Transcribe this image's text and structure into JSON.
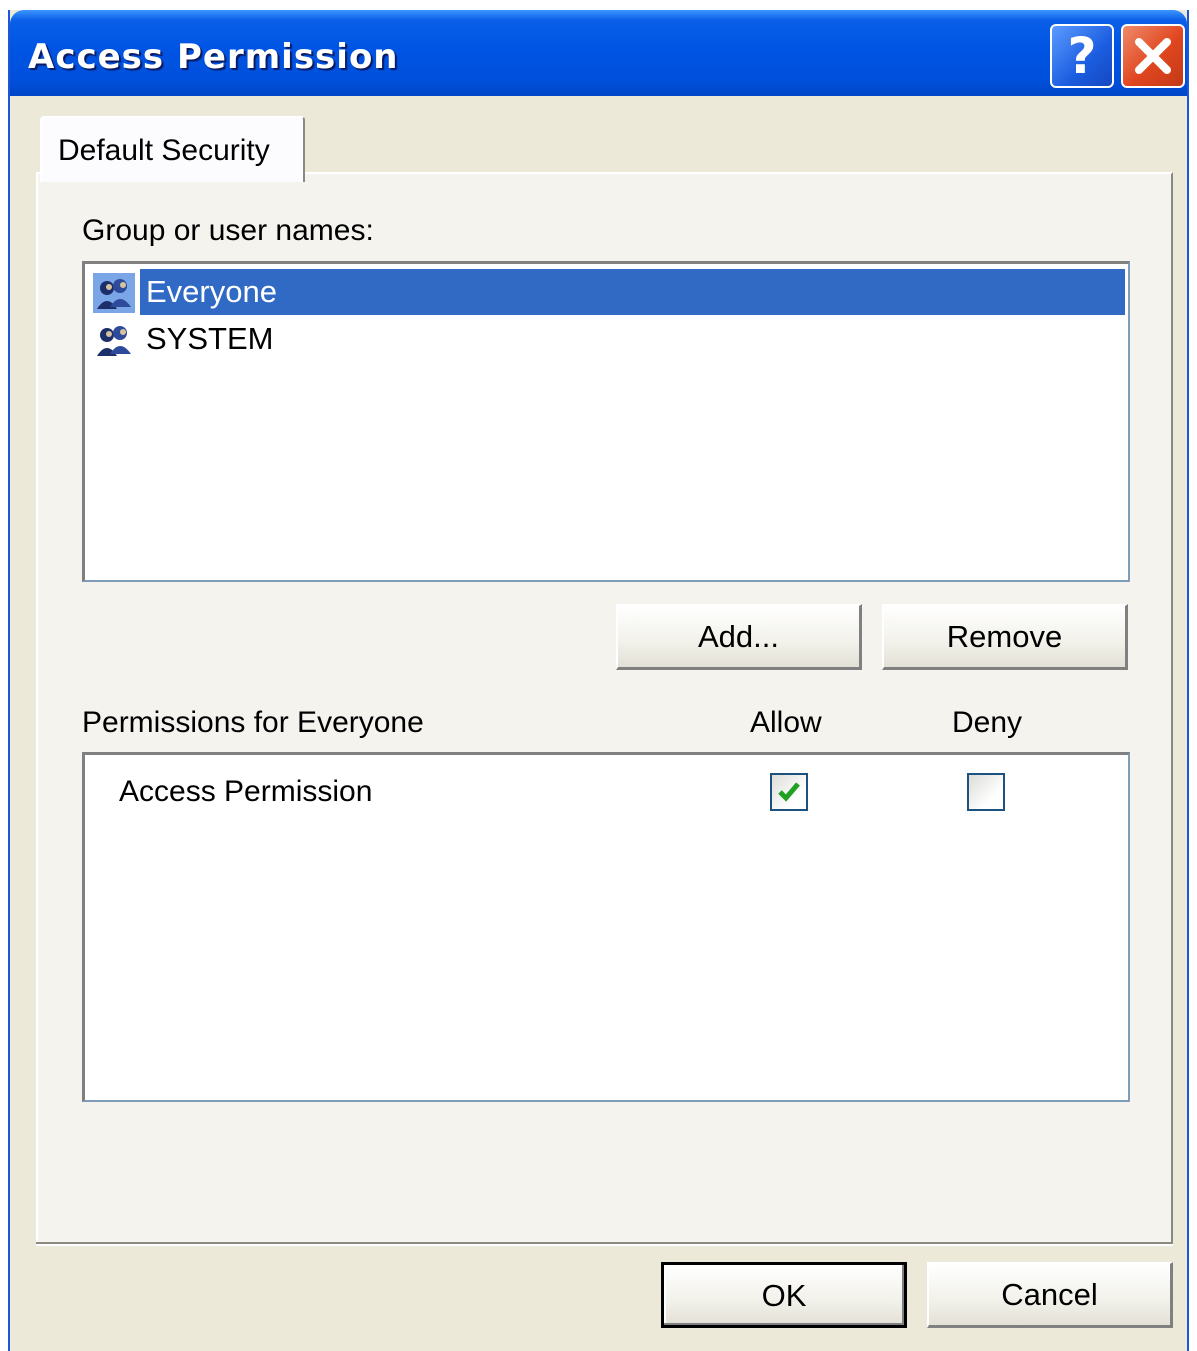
{
  "window": {
    "title": "Access Permission"
  },
  "titlebar": {
    "help_label": "?",
    "close_icon": "close-icon"
  },
  "tabs": [
    {
      "label": "Default Security",
      "active": true
    }
  ],
  "groups": {
    "label": "Group or user names:",
    "items": [
      {
        "name": "Everyone",
        "icon": "users-group-icon",
        "selected": true
      },
      {
        "name": "SYSTEM",
        "icon": "users-group-icon",
        "selected": false
      }
    ],
    "add_label": "Add...",
    "remove_label": "Remove"
  },
  "permissions": {
    "label": "Permissions for Everyone",
    "allow_header": "Allow",
    "deny_header": "Deny",
    "rows": [
      {
        "name": "Access Permission",
        "allow": true,
        "deny": false
      }
    ]
  },
  "footer": {
    "ok_label": "OK",
    "cancel_label": "Cancel"
  },
  "colors": {
    "selection": "#316ac5",
    "titlebar": "#0054e3",
    "dialog_bg": "#ece9d8",
    "check": "#21a121"
  }
}
